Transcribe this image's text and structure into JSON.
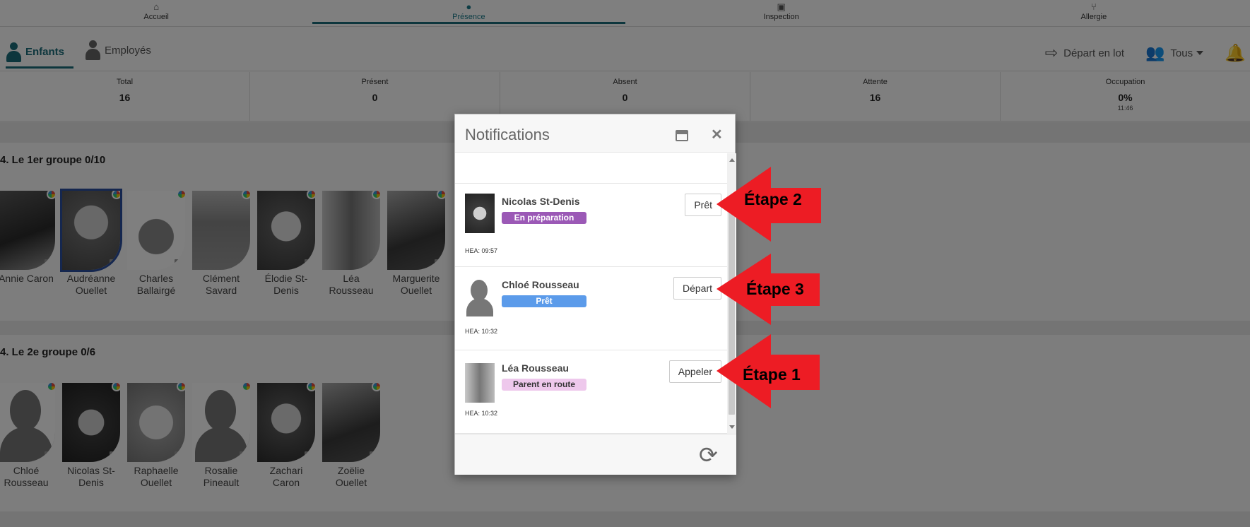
{
  "topnav": {
    "tabs": [
      {
        "label": "Accueil",
        "icon": "home-icon"
      },
      {
        "label": "Présence",
        "icon": "attendance-icon",
        "active": true
      },
      {
        "label": "Inspection",
        "icon": "clipboard-icon"
      },
      {
        "label": "Allergie",
        "icon": "utensils-icon"
      }
    ]
  },
  "subnav": {
    "enfants": "Enfants",
    "employes": "Employés",
    "depart_lot": "Départ en lot",
    "filter": "Tous"
  },
  "stats": [
    {
      "label": "Total",
      "value": "16"
    },
    {
      "label": "Présent",
      "value": "0"
    },
    {
      "label": "Absent",
      "value": "0"
    },
    {
      "label": "Attente",
      "value": "16"
    },
    {
      "label": "Occupation",
      "value": "0%",
      "sub": "11:46"
    }
  ],
  "groups": [
    {
      "title": "4. Le 1er groupe 0/10",
      "kids": [
        {
          "name": "Annie Caron"
        },
        {
          "name": "Audréanne Ouellet"
        },
        {
          "name": "Charles Ballairgé"
        },
        {
          "name": "Clément Savard"
        },
        {
          "name": "Élodie St-Denis"
        },
        {
          "name": "Léa Rousseau"
        },
        {
          "name": "Marguerite Ouellet"
        }
      ]
    },
    {
      "title": "4. Le 2e groupe 0/6",
      "kids": [
        {
          "name": "Chloé Rousseau"
        },
        {
          "name": "Nicolas St-Denis"
        },
        {
          "name": "Raphaelle Ouellet"
        },
        {
          "name": "Rosalie Pineault"
        },
        {
          "name": "Zachari Caron"
        },
        {
          "name": "Zoëlie Ouellet"
        }
      ]
    }
  ],
  "modal": {
    "title": "Notifications",
    "items": [
      {
        "name": "Nicolas St-Denis",
        "status": "En préparation",
        "status_color": "#9b59b6",
        "time": "HEA: 09:57",
        "button": "Prêt"
      },
      {
        "name": "Chloé Rousseau",
        "status": "Prêt",
        "status_color": "#5b9bea",
        "time": "HEA: 10:32",
        "button": "Départ"
      },
      {
        "name": "Léa Rousseau",
        "status": "Parent en route",
        "status_color": "#eec8ec",
        "time": "HEA: 10:32",
        "button": "Appeler"
      }
    ]
  },
  "annotations": [
    {
      "label": "Étape 2"
    },
    {
      "label": "Étape 3"
    },
    {
      "label": "Étape 1"
    }
  ],
  "colors": {
    "accent": "#1a6d7a",
    "arrow": "#ed1c24"
  }
}
